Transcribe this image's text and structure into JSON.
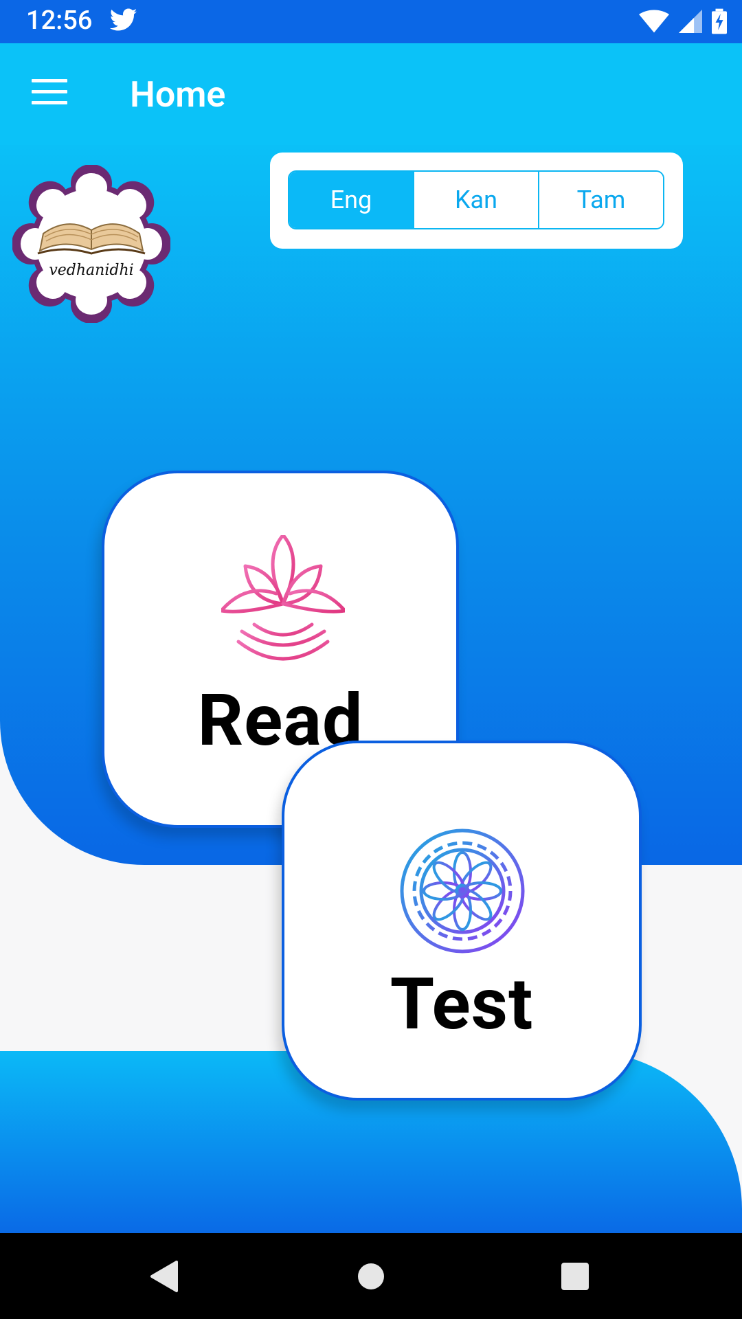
{
  "status_bar": {
    "time": "12:56",
    "icons": [
      "twitter-icon",
      "wifi-icon",
      "signal-icon",
      "battery-charging-icon"
    ]
  },
  "app_bar": {
    "menu_icon": "hamburger-menu-icon",
    "title": "Home"
  },
  "logo": {
    "text": "vedhanidhi"
  },
  "language_selector": {
    "options": [
      "Eng",
      "Kan",
      "Tam"
    ],
    "selected": "Eng"
  },
  "cards": {
    "read": {
      "label": "Read",
      "icon": "lotus-icon"
    },
    "test": {
      "label": "Test",
      "icon": "mandala-gear-icon"
    }
  },
  "nav_bar": {
    "icons": [
      "back-icon",
      "home-icon",
      "recents-icon"
    ]
  },
  "colors": {
    "status_bar": "#0b67e6",
    "app_bar": "#0bc2f8",
    "accent": "#0bb9f7",
    "card_border": "#0b5fe0",
    "lotus": "#e84a9b",
    "mandala_start": "#1fa8e0",
    "mandala_end": "#8a3ff0"
  }
}
